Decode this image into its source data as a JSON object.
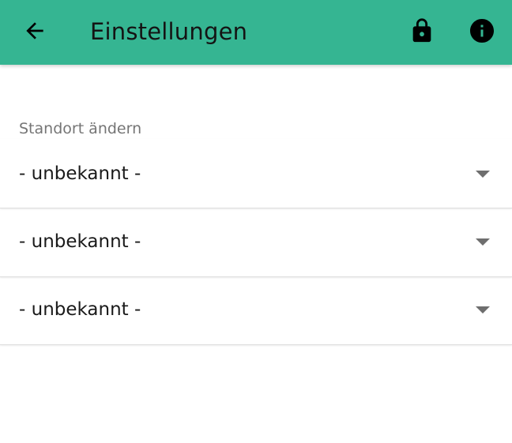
{
  "appbar": {
    "title": "Einstellungen",
    "back_icon": "arrow-back-icon",
    "lock_icon": "lock-icon",
    "info_icon": "info-icon",
    "background_color": "#35b592"
  },
  "location": {
    "section_label": "Standort ändern",
    "dropdowns": [
      {
        "value": "- unbekannt -"
      },
      {
        "value": "- unbekannt -"
      },
      {
        "value": "- unbekannt -"
      }
    ]
  }
}
